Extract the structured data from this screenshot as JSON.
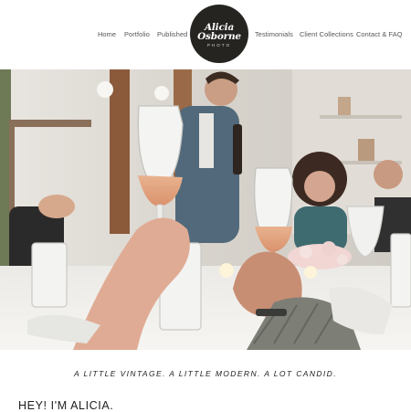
{
  "nav": {
    "left_links": [
      "Home",
      "Portfolio",
      "Published"
    ],
    "right_links": [
      "Testimonials",
      "Client Collections",
      "Contact & FAQ"
    ]
  },
  "logo": {
    "line1": "Alicia",
    "line2": "Osborne",
    "line3": "PHOTO"
  },
  "hero": {
    "description_icon": "celebration-toast-photo"
  },
  "tagline": "A LITTLE VINTAGE. A LITTLE MODERN. A LOT CANDID.",
  "heading": "HEY! I'M ALICIA.",
  "colors": {
    "logo_bg": "#262421",
    "nav_text": "#555555",
    "page_bg": "#ffffff"
  }
}
